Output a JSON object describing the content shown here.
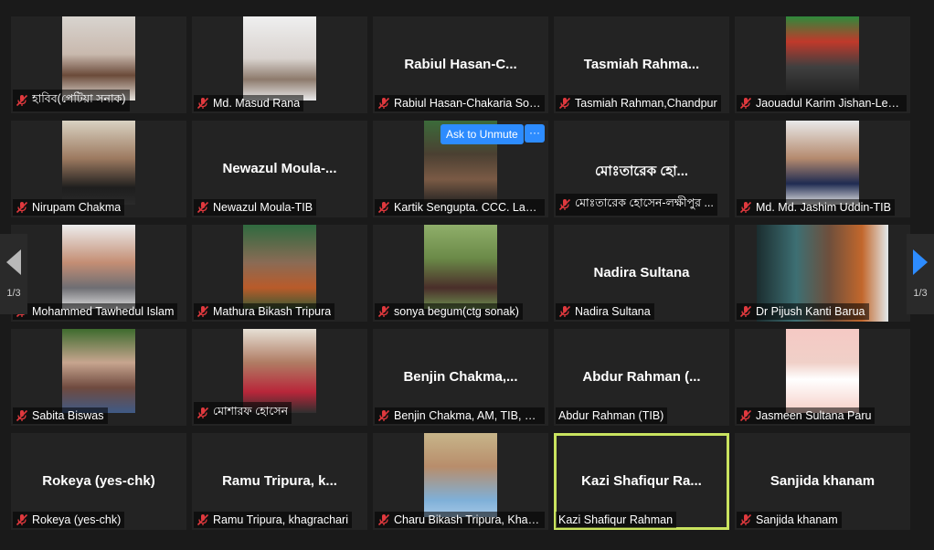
{
  "controls": {
    "ask_to_unmute": "Ask to Unmute",
    "more_options": "···",
    "page_indicator_left": "1/3",
    "page_indicator_right": "1/3"
  },
  "colors": {
    "active_speaker_border": "#c9e35f",
    "accent_blue": "#2d8cff",
    "muted_mic_red": "#e0393e",
    "tile_bg": "#232323"
  },
  "tiles": [
    {
      "label": "হাবিব(পেটিয়া সনাক)",
      "display": "",
      "muted": true,
      "photo": "p1"
    },
    {
      "label": "Md. Masud Rana",
      "display": "",
      "muted": true,
      "photo": "p2"
    },
    {
      "label": "Rabiul Hasan-Chakaria Son...",
      "display": "Rabiul  Hasan-C...",
      "muted": true,
      "photo": ""
    },
    {
      "label": "Tasmiah Rahman,Chandpur",
      "display": "Tasmiah  Rahma...",
      "muted": true,
      "photo": ""
    },
    {
      "label": "Jaouadul Karim Jishan-Lea...",
      "display": "",
      "muted": true,
      "photo": "p3"
    },
    {
      "label": "Nirupam Chakma",
      "display": "",
      "muted": true,
      "photo": "p4"
    },
    {
      "label": "Newazul Moula-TIB",
      "display": "Newazul  Moula-...",
      "muted": true,
      "photo": ""
    },
    {
      "label": "Kartik Sengupta. CCC. Laks...",
      "display": "",
      "muted": true,
      "photo": "p5"
    },
    {
      "label": "মোঃতারেক হোসেন-লক্ষীপুর ...",
      "display": "মোঃতারেক  হো...",
      "muted": true,
      "photo": ""
    },
    {
      "label": "Md. Md. Jashim Uddin-TIB",
      "display": "",
      "muted": true,
      "photo": "p6"
    },
    {
      "label": "Mohammed Tawhedul Islam",
      "display": "",
      "muted": true,
      "photo": "p7"
    },
    {
      "label": "Mathura Bikash Tripura",
      "display": "",
      "muted": true,
      "photo": "p8"
    },
    {
      "label": "sonya begum(ctg sonak)",
      "display": "",
      "muted": true,
      "photo": "p9"
    },
    {
      "label": "Nadira Sultana",
      "display": "Nadira Sultana",
      "muted": true,
      "photo": ""
    },
    {
      "label": "Dr Pijush Kanti Barua",
      "display": "",
      "muted": true,
      "photo": "p10"
    },
    {
      "label": "Sabita Biswas",
      "display": "",
      "muted": true,
      "photo": "p11"
    },
    {
      "label": "মোশারফ হোসেন",
      "display": "",
      "muted": true,
      "photo": "p12"
    },
    {
      "label": "Benjin Chakma, AM, TIB, Ra...",
      "display": "Benjin  Chakma,...",
      "muted": true,
      "photo": ""
    },
    {
      "label": "Abdur Rahman (TIB)",
      "display": "Abdur  Rahman  (...",
      "muted": false,
      "photo": ""
    },
    {
      "label": "Jasmeen Sultana Paru",
      "display": "",
      "muted": true,
      "photo": "p13"
    },
    {
      "label": "Rokeya (yes-chk)",
      "display": "Rokeya  (yes-chk)",
      "muted": true,
      "photo": ""
    },
    {
      "label": "Ramu Tripura, khagrachari",
      "display": "Ramu  Tripura,  k...",
      "muted": true,
      "photo": ""
    },
    {
      "label": "Charu Bikash Tripura, Khag...",
      "display": "",
      "muted": true,
      "photo": "p14"
    },
    {
      "label": "Kazi Shafiqur Rahman",
      "display": "Kazi  Shafiqur  Ra...",
      "muted": false,
      "photo": ""
    },
    {
      "label": "Sanjida khanam",
      "display": "Sanjida khanam",
      "muted": true,
      "photo": ""
    }
  ]
}
